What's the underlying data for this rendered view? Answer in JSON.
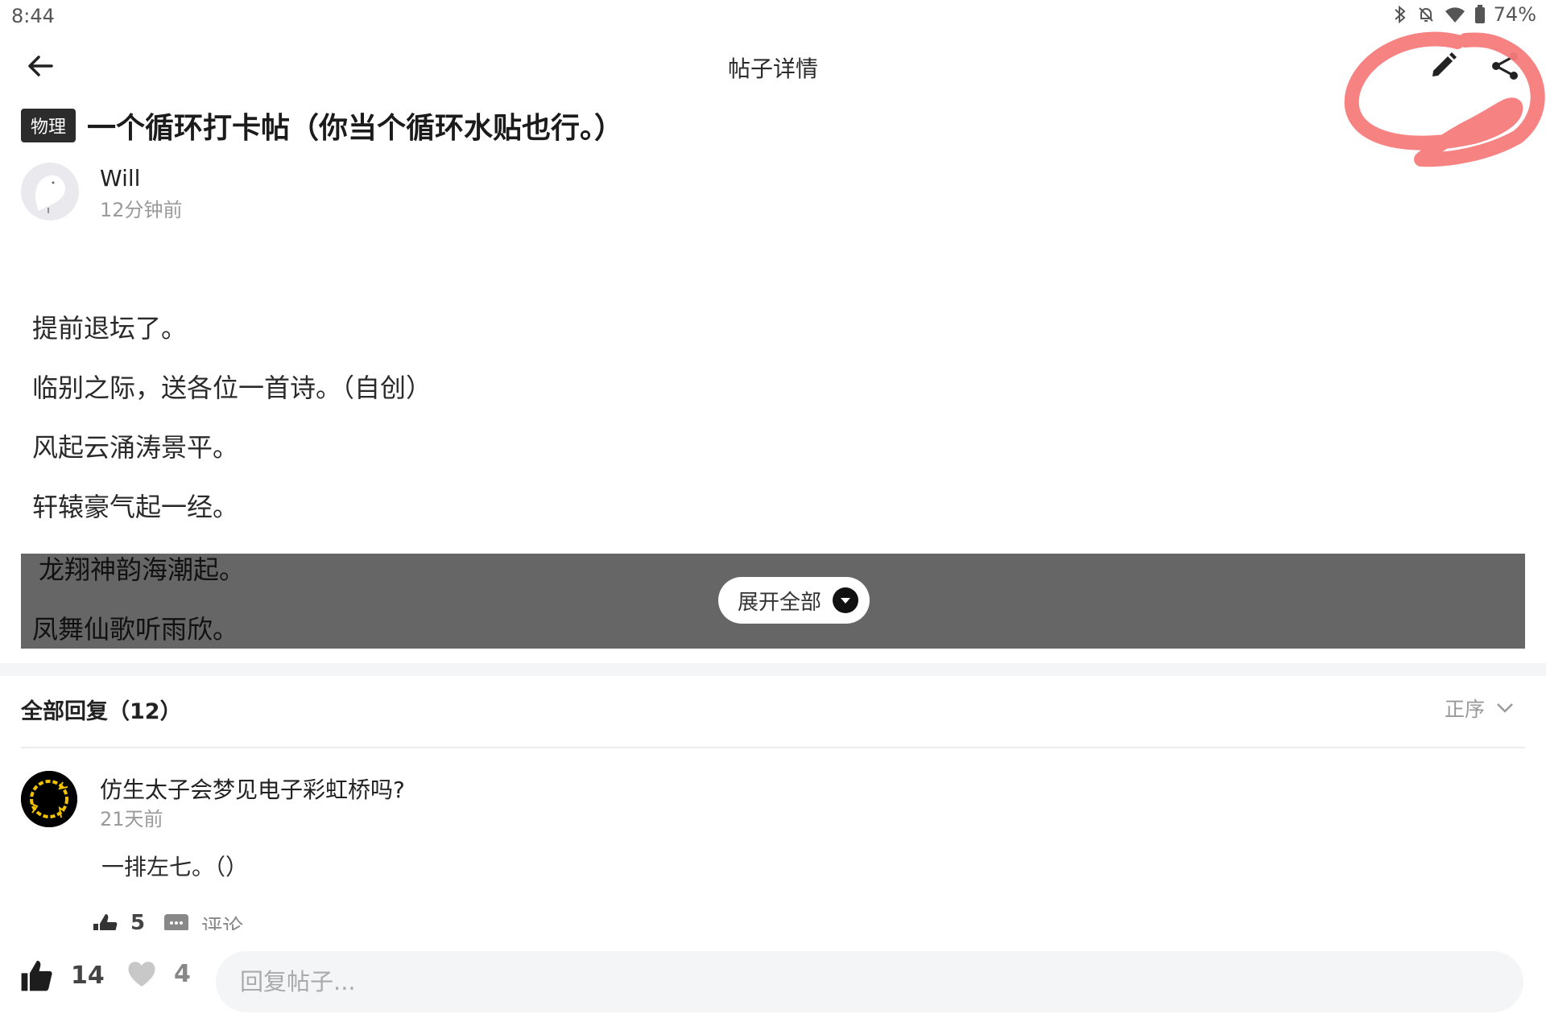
{
  "status_bar": {
    "time": "8:44",
    "battery": "74%",
    "icons": [
      "bluetooth-icon",
      "notifications-off-icon",
      "wifi-icon",
      "battery-icon"
    ]
  },
  "header": {
    "back_icon": "arrow-left-icon",
    "title": "帖子详情",
    "edit_icon": "pencil-icon",
    "share_icon": "share-icon"
  },
  "post": {
    "tag": "物理",
    "title": "一个循环打卡帖（你当个循环水贴也行。）",
    "author": {
      "name": "Will",
      "time": "12分钟前"
    },
    "lines": [
      "提前退坛了。",
      "临别之际，送各位一首诗。（自创）",
      "风起云涌涛景平。",
      "轩辕豪气起一经。",
      "龙翔神韵海潮起。",
      "凤舞仙歌听雨欣。"
    ],
    "expand_label": "展开全部"
  },
  "replies": {
    "title": "全部回复（12）",
    "sort_label": "正序",
    "items": [
      {
        "author": "仿生太子会梦见电子彩虹桥吗?",
        "time": "21天前",
        "text": "一排左七。（）",
        "likes": "5",
        "comment_label": "评论"
      }
    ]
  },
  "bottom_bar": {
    "like_count": "14",
    "favorite_count": "4",
    "reply_placeholder": "回复帖子..."
  },
  "colors": {
    "annotation": "#f77b7b",
    "overlay": "#666666",
    "tag_bg": "#2c2c2c"
  }
}
